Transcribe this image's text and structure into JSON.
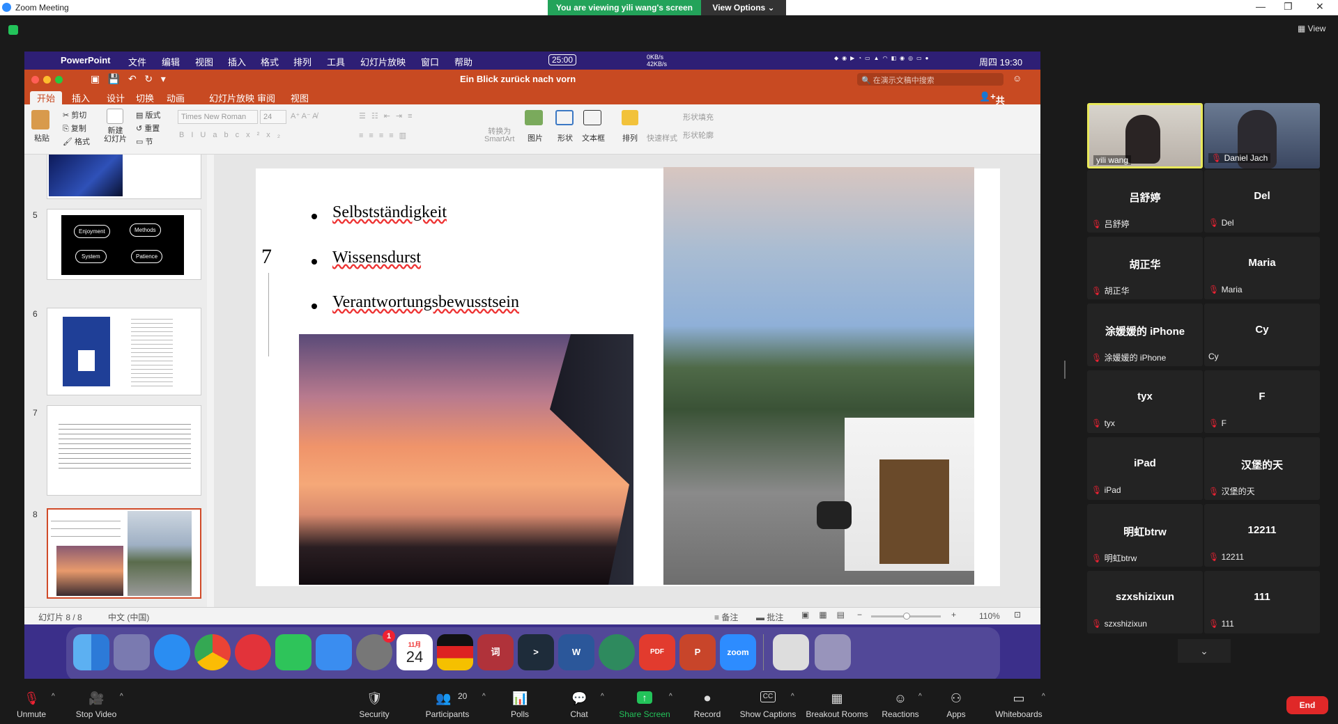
{
  "window": {
    "title": "Zoom Meeting"
  },
  "share_banner": {
    "text": "You are viewing yili wang's screen",
    "view_options": "View Options ⌄"
  },
  "top_right": {
    "view_label": "View"
  },
  "mac_menubar": {
    "app": "PowerPoint",
    "items": [
      "文件",
      "编辑",
      "视图",
      "插入",
      "格式",
      "排列",
      "工具",
      "幻灯片放映",
      "窗口",
      "帮助"
    ],
    "timer": "25:00",
    "net": "0KB/s 42KB/s",
    "clock": "周四 19:30"
  },
  "ppt": {
    "doc_title": "Ein Blick zurück nach vorn",
    "search_placeholder": "在演示文稿中搜索",
    "share": "共享",
    "tabs": [
      "开始",
      "插入",
      "设计",
      "切换",
      "动画",
      "幻灯片放映",
      "审阅",
      "视图"
    ],
    "ribbon": {
      "paste": "粘贴",
      "cut": "剪切",
      "copy": "复制",
      "format": "格式",
      "new_slide": "新建\n幻灯片",
      "layout": "版式",
      "reset": "重置",
      "section": "节",
      "font": "Times New Roman",
      "size": "24",
      "smartart": "转换为\nSmartArt",
      "picture": "图片",
      "shape": "形状",
      "textbox": "文本框",
      "arrange": "排列",
      "quick_styles": "快速样式",
      "shape_fill": "形状填充",
      "shape_outline": "形状轮廓"
    },
    "thumbnails": [
      {
        "num": "5",
        "labels": [
          "Enjoyment",
          "Methods",
          "System",
          "Patience"
        ]
      },
      {
        "num": "6"
      },
      {
        "num": "7"
      },
      {
        "num": "8"
      }
    ],
    "slide": {
      "number": "7",
      "bullets": [
        "Selbstständigkeit",
        "Wissensdurst",
        "Verantwortungsbewusstsein"
      ]
    },
    "status": {
      "slide": "幻灯片 8 / 8",
      "lang": "中文 (中国)",
      "notes": "备注",
      "comments": "批注",
      "zoom": "110%"
    }
  },
  "dock": {
    "word_label": "W",
    "zoom_label": "zoom",
    "calendar_month": "11月",
    "calendar_day": "24",
    "settings_badge": "1",
    "pdf_label": "PDF"
  },
  "participants": [
    {
      "name": "yili wang",
      "video": true,
      "active": true
    },
    {
      "name": "Daniel Jach",
      "video": true
    },
    {
      "name": "吕舒婷",
      "label": "吕舒婷"
    },
    {
      "name": "Del",
      "label": "Del"
    },
    {
      "name": "胡正华",
      "label": "胡正华"
    },
    {
      "name": "Maria",
      "label": "Maria"
    },
    {
      "name": "涂媛媛的 iPhone",
      "label": "涂媛媛的 iPhone"
    },
    {
      "name": "Cy",
      "label": "Cy"
    },
    {
      "name": "tyx",
      "label": "tyx"
    },
    {
      "name": "F",
      "label": "F"
    },
    {
      "name": "iPad",
      "label": "iPad"
    },
    {
      "name": "汉堡的天",
      "label": "汉堡的天"
    },
    {
      "name": "明虹btrw",
      "label": "明虹btrw"
    },
    {
      "name": "12211",
      "label": "12211"
    },
    {
      "name": "szxshizixun",
      "label": "szxshizixun"
    },
    {
      "name": "111",
      "label": "111"
    }
  ],
  "toolbar": {
    "unmute": "Unmute",
    "stop_video": "Stop Video",
    "security": "Security",
    "participants": "Participants",
    "participant_count": "20",
    "polls": "Polls",
    "chat": "Chat",
    "share": "Share Screen",
    "record": "Record",
    "captions": "Show Captions",
    "breakout": "Breakout Rooms",
    "reactions": "Reactions",
    "apps": "Apps",
    "whiteboards": "Whiteboards",
    "end": "End"
  }
}
